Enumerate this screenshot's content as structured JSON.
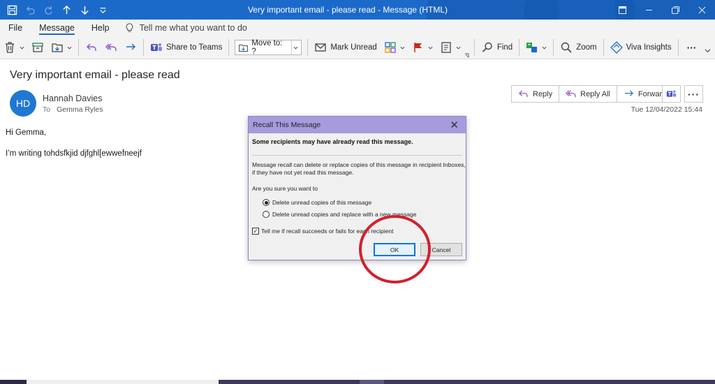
{
  "window": {
    "title": "Very important email - please read  -  Message (HTML)",
    "accent": "#1b6ac9"
  },
  "menu": {
    "tabs": [
      "File",
      "Message",
      "Help"
    ],
    "active_tab": "Message",
    "tell_me": "Tell me what you want to do"
  },
  "ribbon": {
    "share_to_teams": "Share to Teams",
    "move_to": "Move to: ?",
    "mark_unread": "Mark Unread",
    "find": "Find",
    "zoom": "Zoom",
    "viva_insights": "Viva Insights",
    "more": "···"
  },
  "message": {
    "subject": "Very important email - please read",
    "avatar_initials": "HD",
    "avatar_color": "#1f78d1",
    "sender": "Hannah Davies",
    "to_label": "To",
    "to": "Gemma Ryles",
    "date": "Tue 12/04/2022 15:44",
    "body_greeting": "Hi Gemma,",
    "body_line": "I’m writing tohdsfkjid djfghl[ewwefneejf"
  },
  "actions": {
    "reply": "Reply",
    "reply_all": "Reply All",
    "forward": "Forward",
    "more": "···"
  },
  "dialog": {
    "title": "Recall This Message",
    "warning": "Some recipients may have already read this message.",
    "info": "Message recall can delete or replace copies of this message in recipient Inboxes, if they have not yet read this message.",
    "question": "Are you sure you want to",
    "option_delete": "Delete unread copies of this message",
    "option_replace": "Delete unread copies and replace with a new message",
    "selected_option": "delete",
    "checkbox_label": "Tell me if recall succeeds or fails for each recipient",
    "checkbox_checked": true,
    "ok": "OK",
    "cancel": "Cancel",
    "close": "✕"
  },
  "annotation": {
    "circle_color": "#d31f2c"
  }
}
